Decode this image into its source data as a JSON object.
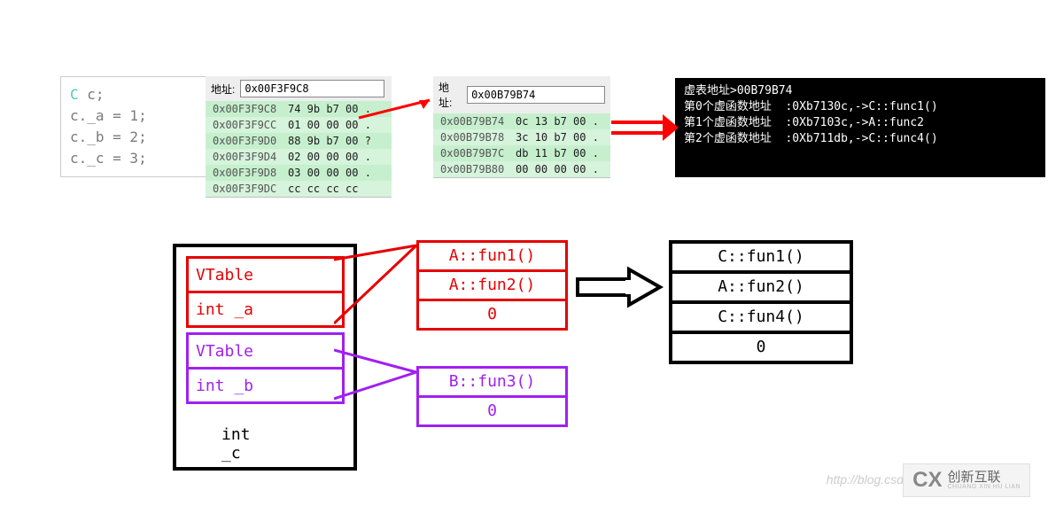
{
  "code": {
    "line1_type": "C",
    "line1_rest": " c;",
    "line2": "c._a = 1;",
    "line3": "c._b = 2;",
    "line4": "c._c = 3;"
  },
  "mem1": {
    "label": "地址:",
    "addr": "0x00F3F9C8",
    "rows": [
      {
        "a": "0x00F3F9C8",
        "b": "74 9b b7 00",
        "dot": "."
      },
      {
        "a": "0x00F3F9CC",
        "b": "01 00 00 00",
        "dot": "."
      },
      {
        "a": "0x00F3F9D0",
        "b": "88 9b b7 00",
        "dot": "?"
      },
      {
        "a": "0x00F3F9D4",
        "b": "02 00 00 00",
        "dot": "."
      },
      {
        "a": "0x00F3F9D8",
        "b": "03 00 00 00",
        "dot": ".",
        "hl": true
      },
      {
        "a": "0x00F3F9DC",
        "b": "cc cc cc cc",
        "dot": ""
      }
    ]
  },
  "mem2": {
    "label": "地址:",
    "addr": "0x00B79B74",
    "rows": [
      {
        "a": "0x00B79B74",
        "b": "0c 13 b7 00",
        "dot": "."
      },
      {
        "a": "0x00B79B78",
        "b": "3c 10 b7 00",
        "dot": "."
      },
      {
        "a": "0x00B79B7C",
        "b": "db 11 b7 00",
        "dot": "."
      },
      {
        "a": "0x00B79B80",
        "b": "00 00 00 00",
        "dot": "."
      }
    ]
  },
  "console": {
    "line1": "虚表地址>00B79B74",
    "line2": "第0个虚函数地址  :0Xb7130c,->C::func1()",
    "line3": "第1个虚函数地址  :0Xb7103c,->A::func2",
    "line4": "第2个虚函数地址  :0Xb711db,->C::func4()"
  },
  "diagram": {
    "left": {
      "red1": "VTable",
      "red2": "int _a",
      "purple1": "VTable",
      "purple2": "int _b",
      "black": "int _c"
    },
    "redTable": [
      "A::fun1()",
      "A::fun2()",
      "0"
    ],
    "purpleTable": [
      "B::fun3()",
      "0"
    ],
    "blackTable": [
      "C::fun1()",
      "A::fun2()",
      "C::fun4()",
      "0"
    ]
  },
  "watermark": "http://blog.csdn.net/",
  "logo": {
    "cx": "CX",
    "name": "创新互联",
    "sub": "CHUANG XIN HU LIAN"
  }
}
